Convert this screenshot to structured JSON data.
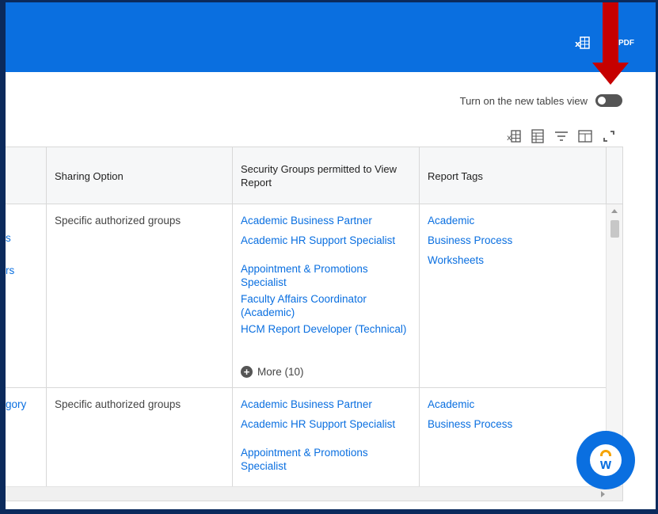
{
  "header": {
    "excel_icon": "excel-export-icon",
    "pdf_label": "PDF"
  },
  "toggle": {
    "label": "Turn on the new tables view",
    "state": "off"
  },
  "toolbar": {
    "icons": [
      "excel-export-icon",
      "grid-icon",
      "filter-icon",
      "columns-icon",
      "fullscreen-icon"
    ]
  },
  "table": {
    "columns": [
      {
        "label": ""
      },
      {
        "label": "Sharing Option"
      },
      {
        "label": "Security Groups permitted to View Report"
      },
      {
        "label": "Report Tags"
      }
    ],
    "rows": [
      {
        "col0": [
          "s",
          "rs"
        ],
        "sharing": "Specific authorized groups",
        "groups": [
          "Academic Business Partner",
          "Academic HR Support Specialist",
          "Appointment & Promotions Specialist",
          "Faculty Affairs Coordinator (Academic)",
          "HCM Report Developer (Technical)"
        ],
        "more": "More (10)",
        "tags": [
          "Academic",
          "Business Process",
          "Worksheets"
        ]
      },
      {
        "col0": [
          "gory"
        ],
        "sharing": "Specific authorized groups",
        "groups": [
          "Academic Business Partner",
          "Academic HR Support Specialist",
          "Appointment & Promotions Specialist"
        ],
        "tags": [
          "Academic",
          "Business Process"
        ]
      }
    ]
  },
  "colors": {
    "header_blue": "#0a6fe0",
    "link_blue": "#0a6fe0",
    "annotation_red": "#c60000",
    "frame_navy": "#0b2a5c"
  }
}
